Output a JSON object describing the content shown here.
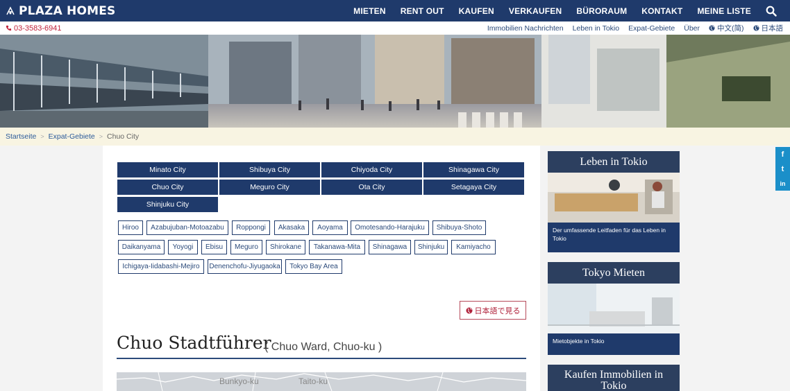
{
  "brand": {
    "name": "PLAZA HOMES"
  },
  "nav": {
    "items": [
      "MIETEN",
      "RENT OUT",
      "KAUFEN",
      "VERKAUFEN",
      "BÜRORAUM",
      "KONTAKT",
      "MEINE LISTE"
    ],
    "search_icon": "search-icon"
  },
  "subnav": {
    "phone": "03-3583-6941",
    "links": [
      "Immobilien Nachrichten",
      "Leben in Tokio",
      "Expat-Gebiete",
      "Über"
    ],
    "lang_links": [
      "中文(简)",
      "日本語"
    ]
  },
  "breadcrumb": [
    "Startseite",
    "Expat-Gebiete",
    "Chuo City"
  ],
  "cities": [
    "Minato City",
    "Shibuya City",
    "Chiyoda City",
    "Shinagawa City",
    "Chuo City",
    "Meguro City",
    "Ota City",
    "Setagaya City",
    "Shinjuku City"
  ],
  "areas": [
    "Hiroo",
    "Azabujuban-Motoazabu",
    "Roppongi",
    "Akasaka",
    "Aoyama",
    "Omotesando-Harajuku",
    "Shibuya-Shoto",
    "Daikanyama",
    "Yoyogi",
    "Ebisu",
    "Meguro",
    "Shirokane",
    "Takanawa-Mita",
    "Shinagawa",
    "Shinjuku",
    "Kamiyacho",
    "Ichigaya-Iidabashi-Mejiro",
    "Denenchofu-Jiyugaoka",
    "Tokyo Bay Area"
  ],
  "japanese_link": "日本語で見る",
  "guide": {
    "title": "Chuo Stadtführer",
    "subtitle": "( Chuo Ward, Chuo-ku )",
    "map_labels": [
      "Bunkyo-ku",
      "Taito-ku"
    ]
  },
  "sidebar": {
    "cards": [
      {
        "title": "Leben in Tokio",
        "caption": "Der umfassende Leitfaden für das Leben in Tokio"
      },
      {
        "title": "Tokyo Mieten",
        "caption": "Mietobjekte in Tokio"
      },
      {
        "title": "Kaufen Immobilien in Tokio",
        "caption": ""
      }
    ]
  },
  "social": [
    "f",
    "t",
    "in"
  ],
  "colors": {
    "navy": "#1f3a6b",
    "accent_red": "#c0223b",
    "crumb_bg": "#f8f4e2",
    "social_blue": "#1b8fc9"
  }
}
